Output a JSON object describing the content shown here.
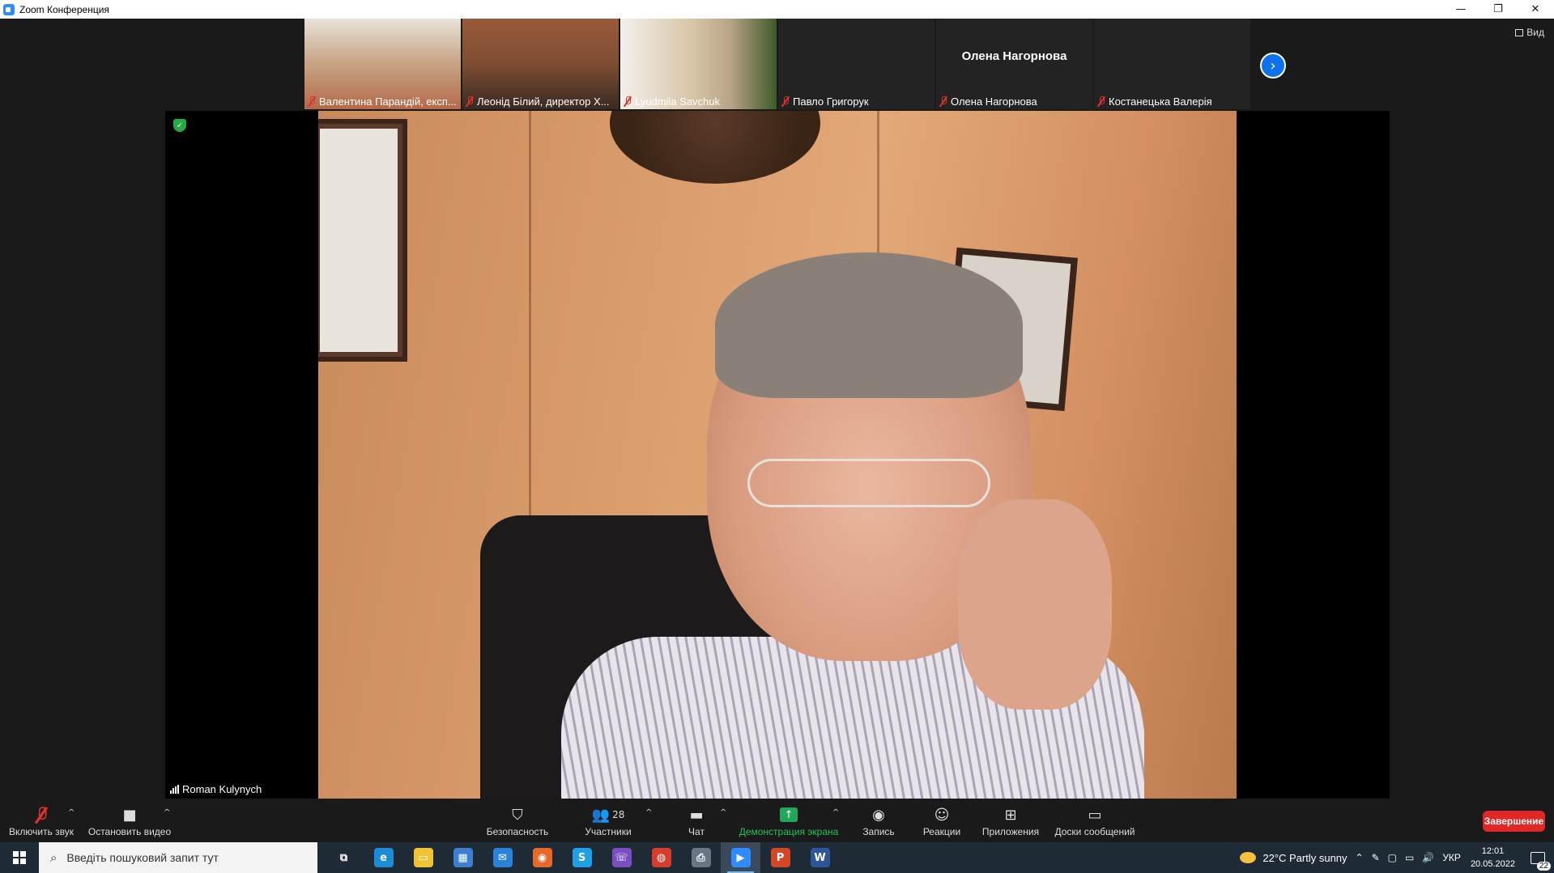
{
  "window": {
    "title": "Zoom Конференция",
    "controls": [
      "—",
      "❐",
      "✕"
    ]
  },
  "gallery": {
    "tiles": [
      {
        "name": "Валентина Парандій, експ...",
        "photo_color": "#c9a889"
      },
      {
        "name": "Леонід Білий, директор Х...",
        "photo_color": "#7d4d32"
      },
      {
        "name": "Lyudmila Savchuk",
        "photo_color": "#b9a488"
      },
      {
        "name": "Павло Григорук",
        "photo_color": ""
      },
      {
        "name": "Олена Нагорнова",
        "big_name": "Олена Нагорнова",
        "photo_color": ""
      },
      {
        "name": "Костанецька Валерія",
        "photo_color": ""
      }
    ],
    "view_label": "Вид"
  },
  "speaker": {
    "name": "Roman Kulynych"
  },
  "toolbar": {
    "unmute": "Включить звук",
    "stop_video": "Остановить видео",
    "security": "Безопасность",
    "participants": "Участники",
    "participants_count": "28",
    "chat": "Чат",
    "share": "Демонстрация экрана",
    "record": "Запись",
    "reactions": "Реакции",
    "apps": "Приложения",
    "whiteboards": "Доски сообщений",
    "end": "Завершение",
    "share_color": "#23a55a",
    "end_color": "#e02828"
  },
  "taskbar": {
    "search_placeholder": "Введіть пошуковий запит тут",
    "apps": [
      {
        "icon": "task-view-icon",
        "color": "#1f2a37",
        "glyph": "⧉"
      },
      {
        "icon": "edge-icon",
        "color": "#1d8bd6",
        "glyph": "e"
      },
      {
        "icon": "file-explorer-icon",
        "color": "#f1c232",
        "glyph": "▭"
      },
      {
        "icon": "store-icon",
        "color": "#3b7fd1",
        "glyph": "▦"
      },
      {
        "icon": "mail-icon",
        "color": "#2a83d9",
        "glyph": "✉"
      },
      {
        "icon": "firefox-icon",
        "color": "#e8682a",
        "glyph": "◉"
      },
      {
        "icon": "skype-icon",
        "color": "#1ea0e6",
        "glyph": "S"
      },
      {
        "icon": "viber-icon",
        "color": "#7a4dc2",
        "glyph": "☏"
      },
      {
        "icon": "chrome-icon",
        "color": "#d93c2b",
        "glyph": "◍"
      },
      {
        "icon": "printer-icon",
        "color": "#6b7684",
        "glyph": "⎙"
      },
      {
        "icon": "zoom-icon",
        "color": "#2d8cff",
        "glyph": "▶",
        "active": true
      },
      {
        "icon": "powerpoint-icon",
        "color": "#d24726",
        "glyph": "P"
      },
      {
        "icon": "word-icon",
        "color": "#2b579a",
        "glyph": "W"
      }
    ],
    "weather": "22°C  Partly sunny",
    "language": "УКР",
    "time": "12:01",
    "date": "20.05.2022",
    "notifications": "22"
  }
}
